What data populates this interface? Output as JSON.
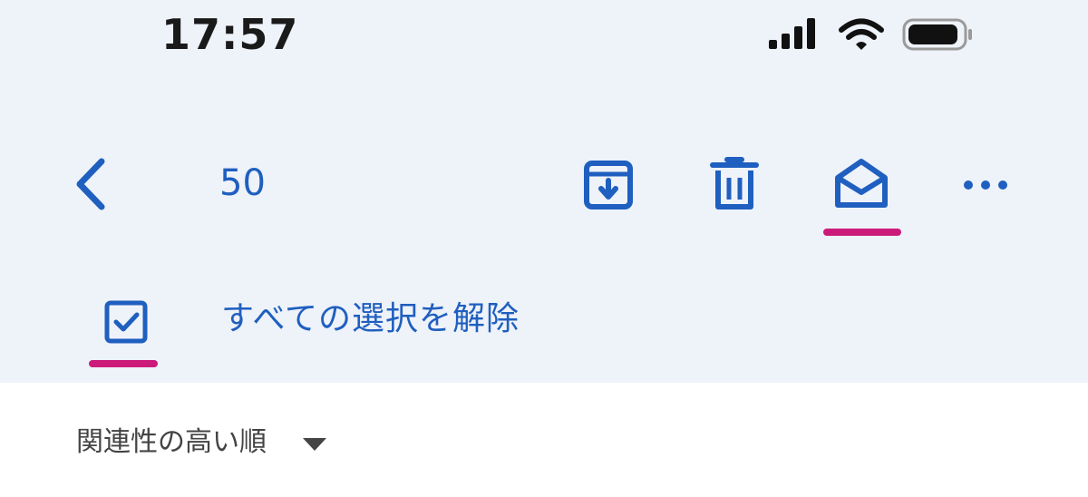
{
  "status_bar": {
    "time": "17:57",
    "signal_icon": "signal-bars-icon",
    "wifi_icon": "wifi-icon",
    "battery_icon": "battery-icon"
  },
  "toolbar": {
    "back_icon": "chevron-left-icon",
    "selected_count": "50",
    "archive_icon": "archive-icon",
    "delete_icon": "trash-icon",
    "mark_read_icon": "open-envelope-icon",
    "more_icon": "more-horizontal-icon"
  },
  "selection": {
    "checkbox_icon": "checked-checkbox-icon",
    "deselect_all_label": "すべての選択を解除"
  },
  "sort": {
    "label": "関連性の高い順",
    "dropdown_icon": "caret-down-icon"
  },
  "colors": {
    "accent": "#1f5fbf",
    "highlight": "#cc1a7a",
    "header_bg": "#eef2f9"
  }
}
